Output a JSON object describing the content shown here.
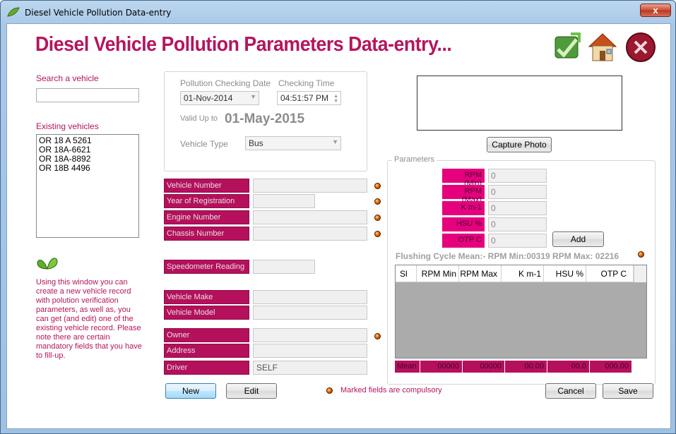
{
  "window": {
    "title": "Diesel Vehicle Pollution Data-entry",
    "close_glyph": "x"
  },
  "header": {
    "title": "Diesel Vehicle Pollution Parameters Data-entry..."
  },
  "search": {
    "label": "Search a vehicle",
    "value": ""
  },
  "existing": {
    "label": "Existing vehicles",
    "items": [
      "OR 18 A 5261",
      "OR 18A-6621",
      "OR 18A-8892",
      "OR 18B 4496"
    ]
  },
  "help": {
    "text": "Using this window you can create a new vehicle record with polution verification parameters, as well as, you can get (and edit) one of the existing vehicle record. Please note there are certain mandatory fields that you have to fill-up."
  },
  "checking": {
    "date_label": "Pollution Checking Date",
    "date_value": "01-Nov-2014",
    "time_label": "Checking Time",
    "time_value": "04:51:57 PM",
    "valid_label": "Valid Up to",
    "valid_value": "01-May-2015",
    "type_label": "Vehicle Type",
    "type_value": "Bus"
  },
  "fields": {
    "vehicle_number": "Vehicle Number",
    "year_of_registration": "Year of Registration",
    "engine_number": "Engine Number",
    "chassis_number": "Chassis Number",
    "speedometer_reading": "Speedometer Reading",
    "vehicle_make": "Vehicle Make",
    "vehicle_model": "Vehicle Model",
    "owner": "Owner",
    "address": "Address",
    "driver": "Driver",
    "driver_value": "SELF"
  },
  "photo": {
    "capture_label": "Capture Photo"
  },
  "parameters": {
    "legend": "Parameters",
    "rows": [
      {
        "label": "RPM (Min)",
        "value": "0"
      },
      {
        "label": "RPM (Max)",
        "value": "0"
      },
      {
        "label": "K m-1",
        "value": "0"
      },
      {
        "label": "HSU %",
        "value": "0"
      },
      {
        "label": "OTP C",
        "value": "0"
      }
    ],
    "add_label": "Add",
    "flushing": "Flushing Cycle Mean:- RPM Min:00319 RPM Max: 02216"
  },
  "grid": {
    "columns": [
      "Sl",
      "RPM Min",
      "RPM Max",
      "K m-1",
      "HSU %",
      "OTP C"
    ],
    "mean": [
      "Mean",
      "00000",
      "00000",
      "00.00",
      "00.0",
      "000.00"
    ]
  },
  "footer": {
    "new_label": "New",
    "edit_label": "Edit",
    "note": "Marked fields are compulsory",
    "cancel_label": "Cancel",
    "save_label": "Save"
  },
  "colors": {
    "brand": "#b5155e",
    "label_bg": "#b5105c",
    "param_bg": "#e6007e"
  }
}
